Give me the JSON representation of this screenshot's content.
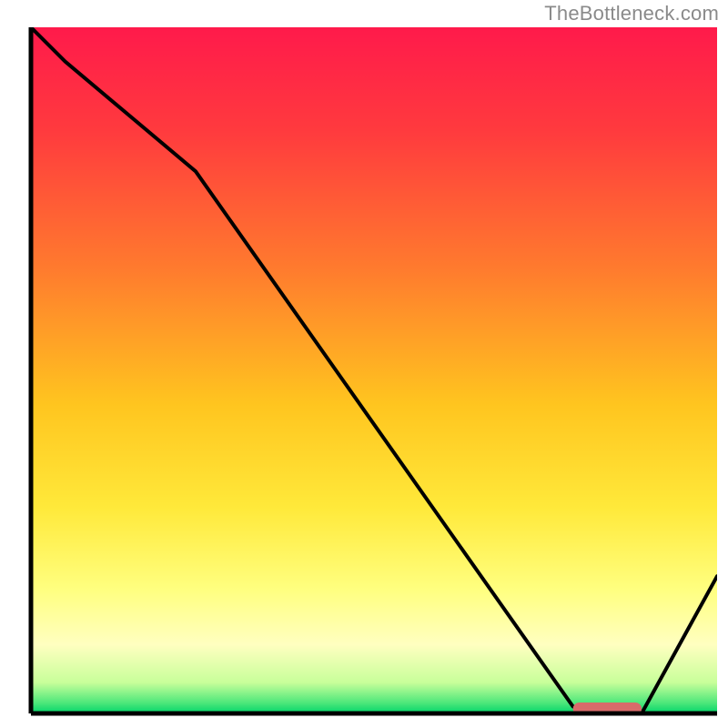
{
  "watermark": "TheBottleneck.com",
  "chart_data": {
    "type": "line",
    "title": "",
    "xlabel": "",
    "ylabel": "",
    "xlim": [
      0,
      100
    ],
    "ylim": [
      0,
      100
    ],
    "x": [
      0,
      5,
      24,
      79,
      83,
      89,
      100
    ],
    "values": [
      100,
      95,
      79,
      1,
      0,
      0,
      20
    ],
    "marker": {
      "x_start": 79,
      "x_end": 89,
      "y": 0
    },
    "gradient_stops": [
      {
        "offset": 0.0,
        "color": "#ff1a4b"
      },
      {
        "offset": 0.15,
        "color": "#ff3a3e"
      },
      {
        "offset": 0.35,
        "color": "#ff7a2e"
      },
      {
        "offset": 0.55,
        "color": "#ffc51f"
      },
      {
        "offset": 0.7,
        "color": "#ffe93a"
      },
      {
        "offset": 0.82,
        "color": "#ffff80"
      },
      {
        "offset": 0.9,
        "color": "#ffffc0"
      },
      {
        "offset": 0.955,
        "color": "#c8ff9a"
      },
      {
        "offset": 0.985,
        "color": "#4be77a"
      },
      {
        "offset": 1.0,
        "color": "#00d46a"
      }
    ],
    "line_color": "#000000",
    "marker_color": "#d96a6a",
    "axis_color": "#000000"
  }
}
